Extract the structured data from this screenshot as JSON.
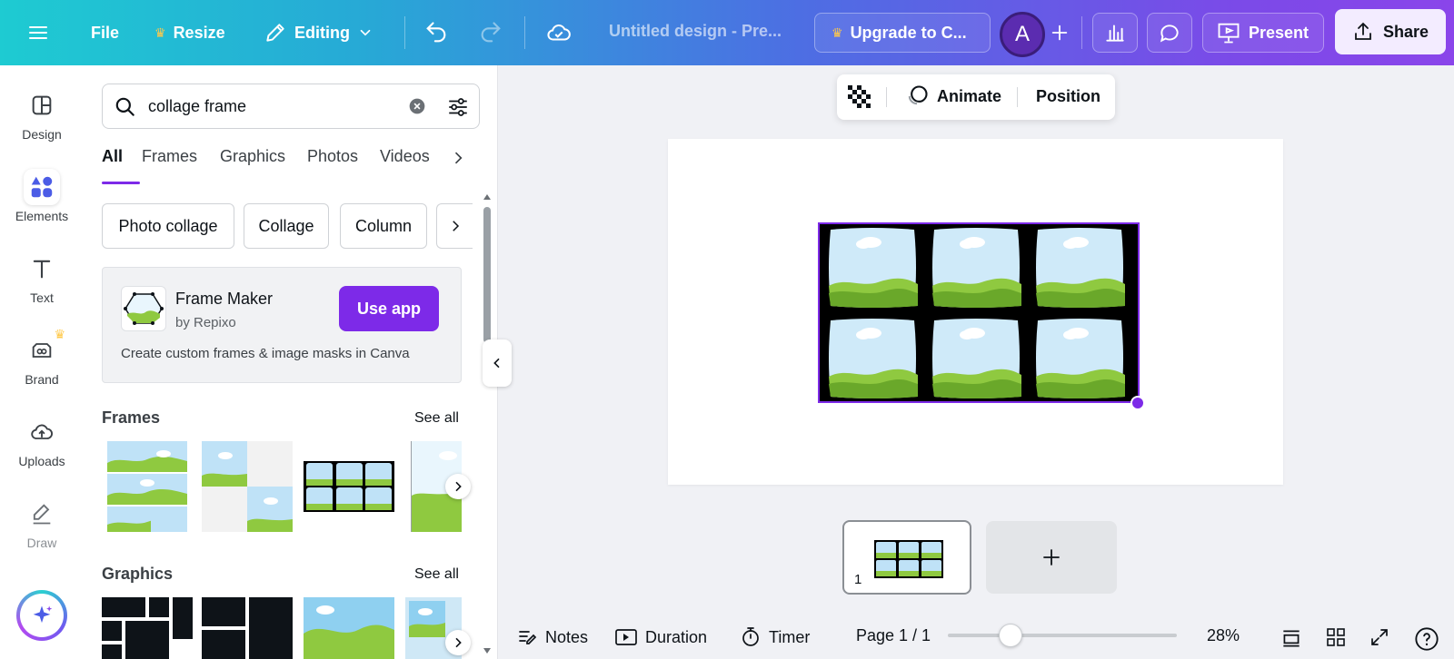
{
  "topbar": {
    "file": "File",
    "resize": "Resize",
    "editing": "Editing",
    "title": "Untitled design - Pre...",
    "upgrade": "Upgrade to C...",
    "avatar_initial": "A",
    "present": "Present",
    "share": "Share"
  },
  "rail": {
    "items": [
      {
        "label": "Design"
      },
      {
        "label": "Elements"
      },
      {
        "label": "Text"
      },
      {
        "label": "Brand"
      },
      {
        "label": "Uploads"
      },
      {
        "label": "Draw"
      }
    ]
  },
  "panel": {
    "search_value": "collage frame",
    "tabs": [
      "All",
      "Frames",
      "Graphics",
      "Photos",
      "Videos"
    ],
    "chips": [
      "Photo collage",
      "Collage",
      "Column"
    ],
    "app": {
      "name": "Frame Maker",
      "by": "by Repixo",
      "button": "Use app",
      "description": "Create custom frames & image masks in Canva"
    },
    "frames_title": "Frames",
    "graphics_title": "Graphics",
    "see_all": "See all"
  },
  "canvas": {
    "animate": "Animate",
    "position": "Position",
    "page_number": "1"
  },
  "bottombar": {
    "notes": "Notes",
    "duration": "Duration",
    "timer": "Timer",
    "page": "Page 1 / 1",
    "zoom": "28%"
  },
  "colors": {
    "accent": "#7d2ae8",
    "selection": "#7d2ae8",
    "sky": "#bfe2f7",
    "grass": "#8fc940"
  }
}
